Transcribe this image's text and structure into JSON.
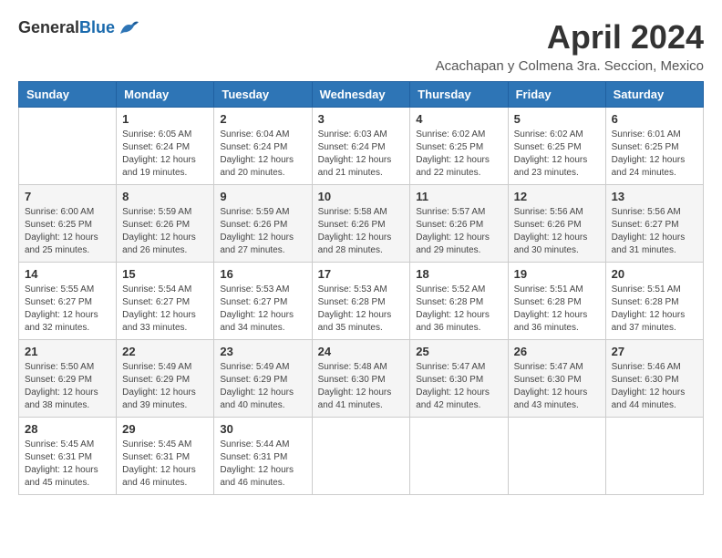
{
  "logo": {
    "general": "General",
    "blue": "Blue"
  },
  "title": "April 2024",
  "subtitle": "Acachapan y Colmena 3ra. Seccion, Mexico",
  "days_of_week": [
    "Sunday",
    "Monday",
    "Tuesday",
    "Wednesday",
    "Thursday",
    "Friday",
    "Saturday"
  ],
  "weeks": [
    [
      {
        "day": "",
        "info": ""
      },
      {
        "day": "1",
        "info": "Sunrise: 6:05 AM\nSunset: 6:24 PM\nDaylight: 12 hours\nand 19 minutes."
      },
      {
        "day": "2",
        "info": "Sunrise: 6:04 AM\nSunset: 6:24 PM\nDaylight: 12 hours\nand 20 minutes."
      },
      {
        "day": "3",
        "info": "Sunrise: 6:03 AM\nSunset: 6:24 PM\nDaylight: 12 hours\nand 21 minutes."
      },
      {
        "day": "4",
        "info": "Sunrise: 6:02 AM\nSunset: 6:25 PM\nDaylight: 12 hours\nand 22 minutes."
      },
      {
        "day": "5",
        "info": "Sunrise: 6:02 AM\nSunset: 6:25 PM\nDaylight: 12 hours\nand 23 minutes."
      },
      {
        "day": "6",
        "info": "Sunrise: 6:01 AM\nSunset: 6:25 PM\nDaylight: 12 hours\nand 24 minutes."
      }
    ],
    [
      {
        "day": "7",
        "info": "Sunrise: 6:00 AM\nSunset: 6:25 PM\nDaylight: 12 hours\nand 25 minutes."
      },
      {
        "day": "8",
        "info": "Sunrise: 5:59 AM\nSunset: 6:26 PM\nDaylight: 12 hours\nand 26 minutes."
      },
      {
        "day": "9",
        "info": "Sunrise: 5:59 AM\nSunset: 6:26 PM\nDaylight: 12 hours\nand 27 minutes."
      },
      {
        "day": "10",
        "info": "Sunrise: 5:58 AM\nSunset: 6:26 PM\nDaylight: 12 hours\nand 28 minutes."
      },
      {
        "day": "11",
        "info": "Sunrise: 5:57 AM\nSunset: 6:26 PM\nDaylight: 12 hours\nand 29 minutes."
      },
      {
        "day": "12",
        "info": "Sunrise: 5:56 AM\nSunset: 6:26 PM\nDaylight: 12 hours\nand 30 minutes."
      },
      {
        "day": "13",
        "info": "Sunrise: 5:56 AM\nSunset: 6:27 PM\nDaylight: 12 hours\nand 31 minutes."
      }
    ],
    [
      {
        "day": "14",
        "info": "Sunrise: 5:55 AM\nSunset: 6:27 PM\nDaylight: 12 hours\nand 32 minutes."
      },
      {
        "day": "15",
        "info": "Sunrise: 5:54 AM\nSunset: 6:27 PM\nDaylight: 12 hours\nand 33 minutes."
      },
      {
        "day": "16",
        "info": "Sunrise: 5:53 AM\nSunset: 6:27 PM\nDaylight: 12 hours\nand 34 minutes."
      },
      {
        "day": "17",
        "info": "Sunrise: 5:53 AM\nSunset: 6:28 PM\nDaylight: 12 hours\nand 35 minutes."
      },
      {
        "day": "18",
        "info": "Sunrise: 5:52 AM\nSunset: 6:28 PM\nDaylight: 12 hours\nand 36 minutes."
      },
      {
        "day": "19",
        "info": "Sunrise: 5:51 AM\nSunset: 6:28 PM\nDaylight: 12 hours\nand 36 minutes."
      },
      {
        "day": "20",
        "info": "Sunrise: 5:51 AM\nSunset: 6:28 PM\nDaylight: 12 hours\nand 37 minutes."
      }
    ],
    [
      {
        "day": "21",
        "info": "Sunrise: 5:50 AM\nSunset: 6:29 PM\nDaylight: 12 hours\nand 38 minutes."
      },
      {
        "day": "22",
        "info": "Sunrise: 5:49 AM\nSunset: 6:29 PM\nDaylight: 12 hours\nand 39 minutes."
      },
      {
        "day": "23",
        "info": "Sunrise: 5:49 AM\nSunset: 6:29 PM\nDaylight: 12 hours\nand 40 minutes."
      },
      {
        "day": "24",
        "info": "Sunrise: 5:48 AM\nSunset: 6:30 PM\nDaylight: 12 hours\nand 41 minutes."
      },
      {
        "day": "25",
        "info": "Sunrise: 5:47 AM\nSunset: 6:30 PM\nDaylight: 12 hours\nand 42 minutes."
      },
      {
        "day": "26",
        "info": "Sunrise: 5:47 AM\nSunset: 6:30 PM\nDaylight: 12 hours\nand 43 minutes."
      },
      {
        "day": "27",
        "info": "Sunrise: 5:46 AM\nSunset: 6:30 PM\nDaylight: 12 hours\nand 44 minutes."
      }
    ],
    [
      {
        "day": "28",
        "info": "Sunrise: 5:45 AM\nSunset: 6:31 PM\nDaylight: 12 hours\nand 45 minutes."
      },
      {
        "day": "29",
        "info": "Sunrise: 5:45 AM\nSunset: 6:31 PM\nDaylight: 12 hours\nand 46 minutes."
      },
      {
        "day": "30",
        "info": "Sunrise: 5:44 AM\nSunset: 6:31 PM\nDaylight: 12 hours\nand 46 minutes."
      },
      {
        "day": "",
        "info": ""
      },
      {
        "day": "",
        "info": ""
      },
      {
        "day": "",
        "info": ""
      },
      {
        "day": "",
        "info": ""
      }
    ]
  ]
}
